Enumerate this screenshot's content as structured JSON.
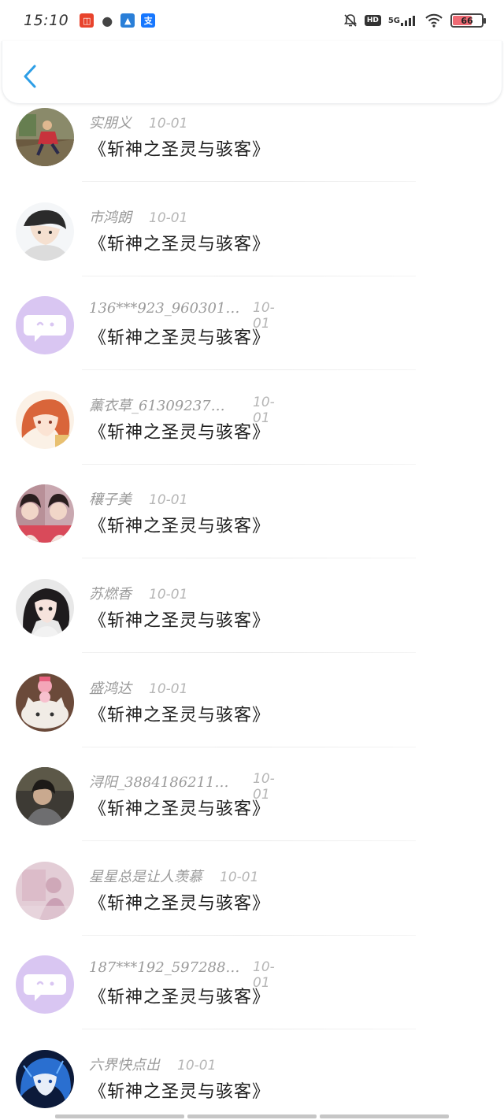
{
  "status_bar": {
    "time": "15:10",
    "network": "5G",
    "hd": "HD",
    "battery": "66",
    "battery_level": 0.66
  },
  "header": {
    "back_icon": "chevron-left-icon"
  },
  "comments": [
    {
      "name": "实朋义",
      "date": "10-01",
      "text": "《斩神之圣灵与骇客》",
      "avatar": "photo-field"
    },
    {
      "name": "市鸿朗",
      "date": "10-01",
      "text": "《斩神之圣灵与骇客》",
      "avatar": "anime-boy"
    },
    {
      "name": "136***923_960301…",
      "date": "10-01",
      "text": "《斩神之圣灵与骇客》",
      "avatar": "default-chat-bubble"
    },
    {
      "name": "薰衣草_61309237…",
      "date": "10-01",
      "text": "《斩神之圣灵与骇客》",
      "avatar": "anime-girl-red-hair"
    },
    {
      "name": "穰子美",
      "date": "10-01",
      "text": "《斩神之圣灵与骇客》",
      "avatar": "two-girls-photo"
    },
    {
      "name": "苏燃香",
      "date": "10-01",
      "text": "《斩神之圣灵与骇客》",
      "avatar": "girl-dark-hair"
    },
    {
      "name": "盛鸿达",
      "date": "10-01",
      "text": "《斩神之圣灵与骇客》",
      "avatar": "cat-with-toy"
    },
    {
      "name": "浔阳_3884186211…",
      "date": "10-01",
      "text": "《斩神之圣灵与骇客》",
      "avatar": "person-dark-photo"
    },
    {
      "name": "星星总是让人羡慕",
      "date": "10-01",
      "text": "《斩神之圣灵与骇客》",
      "avatar": "pink-photo"
    },
    {
      "name": "187***192_597288…",
      "date": "10-01",
      "text": "《斩神之圣灵与骇客》",
      "avatar": "default-chat-bubble"
    },
    {
      "name": "六界快点出",
      "date": "10-01",
      "text": "《斩神之圣灵与骇客》",
      "avatar": "anime-blue-hair"
    }
  ]
}
